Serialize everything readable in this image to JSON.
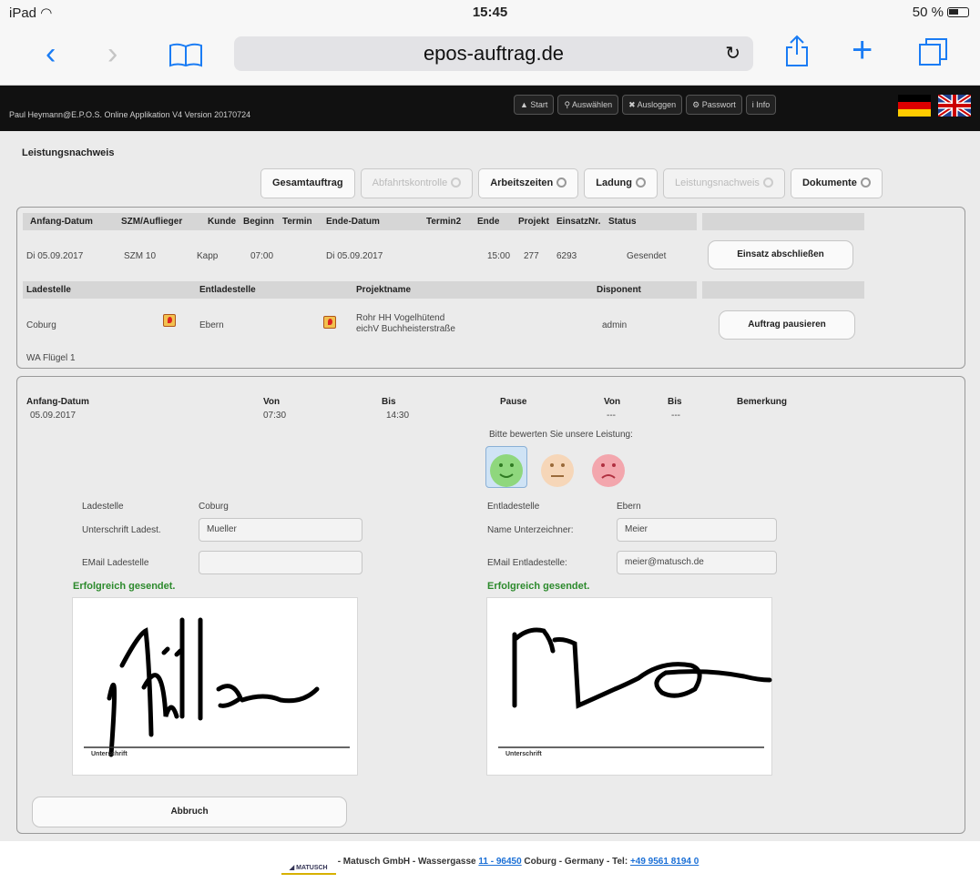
{
  "status": {
    "device": "iPad",
    "wifi_icon": "wifi-icon",
    "time": "15:45",
    "battery": "50 %"
  },
  "browser": {
    "url": "epos-auftrag.de"
  },
  "appbar": {
    "title": "Paul Heymann@E.P.O.S. Online Applikation V4 Version 20170724",
    "nav": [
      "Start",
      "Auswählen",
      "Ausloggen",
      "Passwort",
      "Info"
    ]
  },
  "page": {
    "title": "Leistungsnachweis"
  },
  "tabs": [
    {
      "label": "Gesamtauftrag",
      "enabled": true
    },
    {
      "label": "Abfahrtskontrolle",
      "enabled": false
    },
    {
      "label": "Arbeitszeiten",
      "enabled": true
    },
    {
      "label": "Ladung",
      "enabled": true
    },
    {
      "label": "Leistungsnachweis",
      "enabled": false
    },
    {
      "label": "Dokumente",
      "enabled": true
    }
  ],
  "order": {
    "headers": [
      "Anfang-Datum",
      "SZM/Auflieger",
      "Kunde",
      "Beginn",
      "Termin",
      "Ende-Datum",
      "Termin2",
      "Ende",
      "Projekt",
      "EinsatzNr.",
      "Status"
    ],
    "row": {
      "anfang": "Di 05.09.2017",
      "szm": "SZM 10",
      "kunde": "Kapp",
      "beginn": "07:00",
      "ende_datum": "Di 05.09.2017",
      "ende": "15:00",
      "projekt": "277",
      "einsatznr": "6293",
      "status": "Gesendet"
    },
    "btn_close": "Einsatz abschließen",
    "headers2": [
      "Ladestelle",
      "Entladestelle",
      "Projektname",
      "Disponent"
    ],
    "row2": {
      "ladestelle": "Coburg",
      "entladestelle": "Ebern",
      "projekt_line1": "Rohr HH Vogelhütend",
      "projekt_line2": "eichV Buchheisterstraße",
      "disponent": "admin"
    },
    "btn_pause": "Auftrag pausieren",
    "note": "WA Flügel 1"
  },
  "work": {
    "headers": {
      "anfang": "Anfang-Datum",
      "von": "Von",
      "bis": "Bis",
      "pause": "Pause",
      "von2": "Von",
      "bis2": "Bis",
      "bemerkung": "Bemerkung"
    },
    "values": {
      "anfang": "05.09.2017",
      "von": "07:30",
      "bis": "14:30",
      "von2": "---",
      "bis2": "---"
    },
    "rating_prompt": "Bitte bewerten Sie unsere Leistung:",
    "rating_selected": "good"
  },
  "sign_left": {
    "ladestelle_label": "Ladestelle",
    "ladestelle_value": "Coburg",
    "sig_label": "Unterschrift Ladest.",
    "sig_value": "Mueller",
    "email_label": "EMail Ladestelle",
    "email_value": "",
    "success": "Erfolgreich gesendet.",
    "underline_label": "Unterschrift"
  },
  "sign_right": {
    "ladestelle_label": "Entladestelle",
    "ladestelle_value": "Ebern",
    "sig_label": "Name Unterzeichner:",
    "sig_value": "Meier",
    "email_label": "EMail Entladestelle:",
    "email_value": "meier@matusch.de",
    "success": "Erfolgreich gesendet.",
    "underline_label": "Unterschrift"
  },
  "cancel_label": "Abbruch",
  "footer": {
    "logo": "MATUSCH",
    "text1": "- Matusch GmbH - Wassergasse ",
    "link1": "11 - 96450",
    "text2": " Coburg - Germany - Tel: ",
    "link2": "+49 9561 8194 0"
  },
  "colors": {
    "accent": "#1a7cf4",
    "success": "#2c8a2c",
    "appbar": "#111111"
  }
}
